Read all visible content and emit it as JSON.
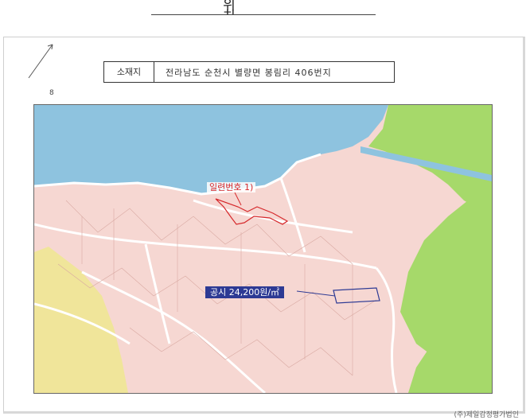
{
  "document": {
    "title": "위 치 도",
    "page_marker": "8",
    "footer": "(주)제일감정평가법인"
  },
  "address": {
    "label": "소재지",
    "value": "전라남도 순천시 별량면 봉림리 406번지"
  },
  "map": {
    "parcel_label": "일련번호 1)",
    "price_label": "공시 24,200원/㎡",
    "colors": {
      "water": "#8ec3df",
      "residential": "#f6d7d2",
      "green": "#a6d96a",
      "yellow": "#f0e59a",
      "road": "#ffffff",
      "parcel_outline": "#d6282b",
      "price_box": "#2d3a94"
    }
  }
}
